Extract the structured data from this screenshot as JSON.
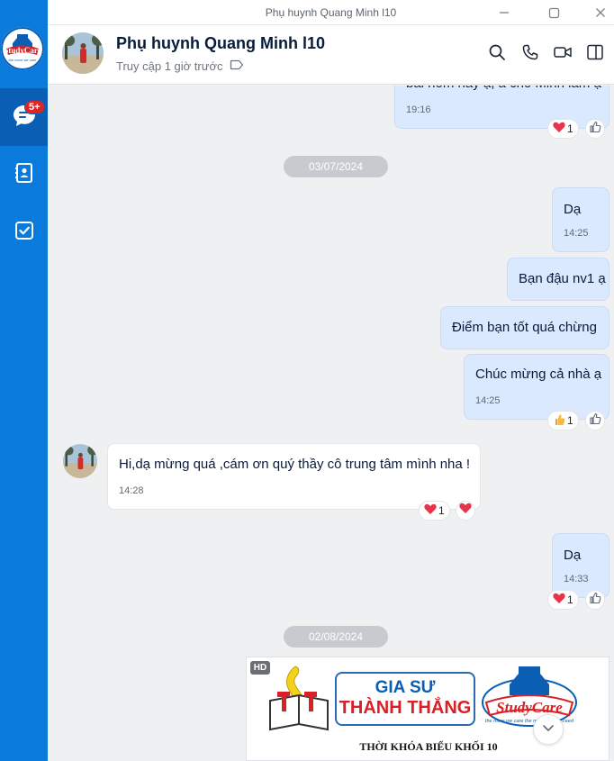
{
  "window": {
    "title": "Phụ huynh Quang Minh l10"
  },
  "sidebar": {
    "logo_text": "StudyCare",
    "logo_tagline": "the more we care",
    "messages_badge": "5+"
  },
  "header": {
    "name": "Phụ huynh Quang Minh l10",
    "status": "Truy cập 1 giờ trước"
  },
  "messages": {
    "m0": {
      "text": "bài hôm nay ạ, a cho Minh làm ạ",
      "time": "19:16",
      "reaction_count": "1"
    },
    "date1": "03/07/2024",
    "m1": {
      "text": "Dạ",
      "time": "14:25"
    },
    "m2": {
      "text": "Bạn đậu nv1 ạ"
    },
    "m3": {
      "text": "Điểm bạn tốt quá chừng"
    },
    "m4": {
      "text": "Chúc mừng cả nhà ạ",
      "time": "14:25",
      "reaction_count": "1"
    },
    "m5": {
      "text": "Hi,dạ mừng quá ,cám ơn quý thầy cô trung tâm mình nha !",
      "time": "14:28",
      "reaction_count": "1"
    },
    "m6": {
      "text": "Dạ",
      "time": "14:33",
      "reaction_count": "1"
    },
    "date2": "02/08/2024",
    "image": {
      "hd_label": "HD",
      "brand_line1": "GIA SƯ",
      "brand_line2": "THÀNH THẮNG",
      "logo_text": "StudyCare",
      "logo_tagline": "the more we care the more you succeed",
      "caption": "THỜI KHÓA BIỂU KHỐI 10"
    }
  },
  "colors": {
    "rail": "#0a7bdc",
    "rail_active": "#0a5fb4",
    "my_bubble": "#dbe9ff",
    "their_bubble": "#ffffff",
    "badge": "#e02424",
    "heart": "#e8334a"
  }
}
